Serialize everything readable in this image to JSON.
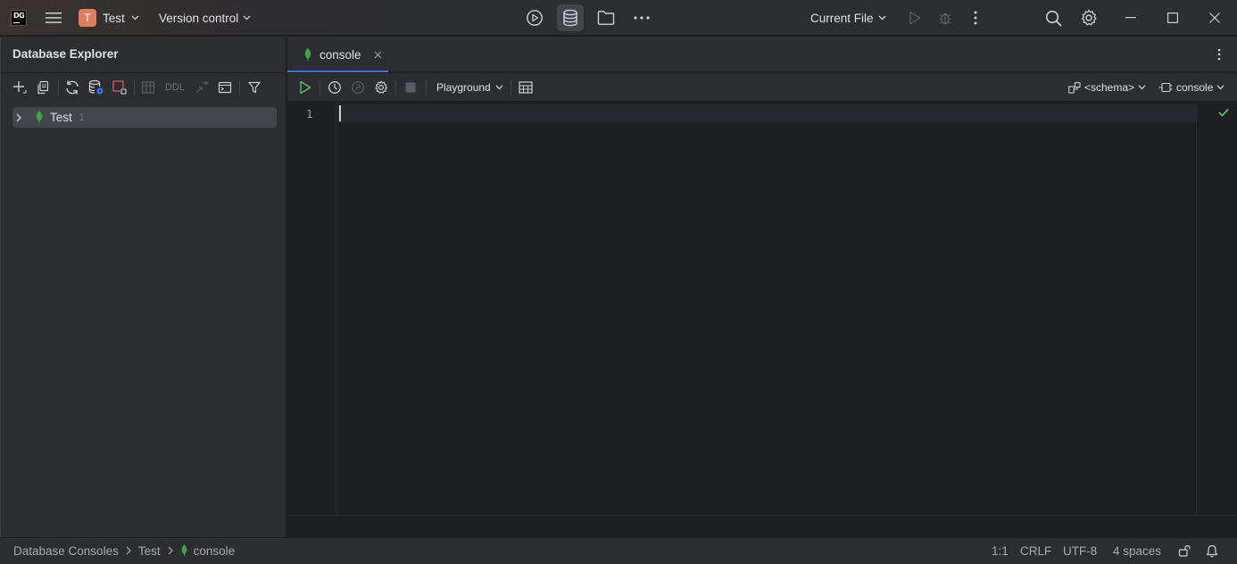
{
  "titlebar": {
    "logo_text": "DG",
    "project_initial": "T",
    "project_name": "Test",
    "version_control": "Version control",
    "run_config": "Current File"
  },
  "explorer": {
    "title": "Database Explorer",
    "ddl_label": "DDL",
    "tree": [
      {
        "label": "Test",
        "count": "1"
      }
    ]
  },
  "editor": {
    "tab_label": "console",
    "playground": "Playground",
    "schema": "<schema>",
    "session": "console",
    "line_numbers": [
      "1"
    ]
  },
  "statusbar": {
    "breadcrumbs": [
      "Database Consoles",
      "Test",
      "console"
    ],
    "position": "1:1",
    "line_ending": "CRLF",
    "encoding": "UTF-8",
    "indent": "4 spaces"
  },
  "colors": {
    "accent": "#3574f0",
    "mongo_leaf": "#3fa34d",
    "project_badge": "#e27d5e",
    "run_green": "#5fb865"
  }
}
